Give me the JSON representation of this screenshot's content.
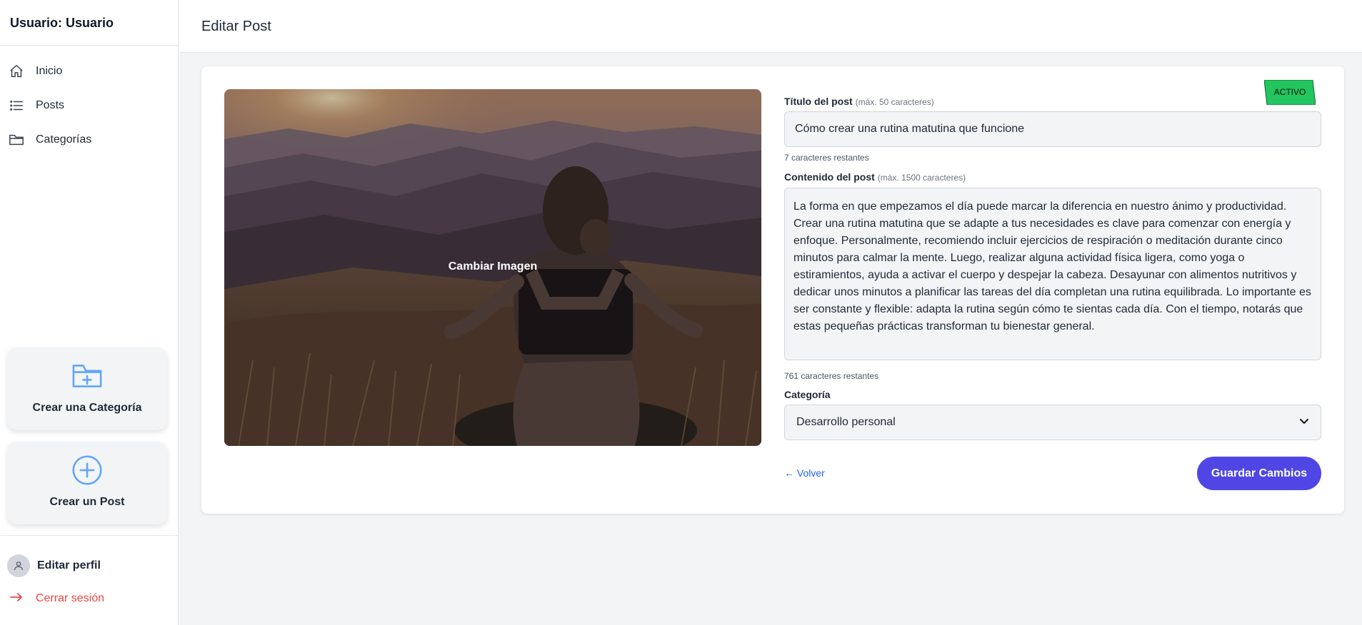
{
  "sidebar": {
    "user": "Usuario: Usuario",
    "nav": [
      {
        "label": "Inicio",
        "icon": "home-icon"
      },
      {
        "label": "Posts",
        "icon": "list-icon"
      },
      {
        "label": "Categorías",
        "icon": "folder-icon"
      }
    ],
    "create_category": "Crear una Categoría",
    "create_post": "Crear un Post",
    "profile": "Editar perfil",
    "logout": "Cerrar sesión"
  },
  "header": {
    "title": "Editar Post"
  },
  "editor": {
    "change_image": "Cambiar Imagen",
    "status": "ACTIVO",
    "status_color": "#22c55e",
    "title_label": "Título del post",
    "title_limit": "(máx. 50 caracteres)",
    "title_value": "Cómo crear una rutina matutina que funcione",
    "title_remaining": "7 caracteres restantes",
    "content_label": "Contenido del post",
    "content_limit": "(máx. 1500 caracteres)",
    "content_value": "La forma en que empezamos el día puede marcar la diferencia en nuestro ánimo y productividad.\nCrear una rutina matutina que se adapte a tus necesidades es clave para comenzar con energía y\nenfoque. Personalmente, recomiendo incluir ejercicios de respiración o meditación durante cinco\nminutos para calmar la mente. Luego, realizar alguna actividad física ligera, como yoga o\nestiramientos, ayuda a activar el cuerpo y despejar la cabeza. Desayunar con alimentos nutritivos y\ndedicar unos minutos a planificar las tareas del día completan una rutina equilibrada. Lo importante es\nser constante y flexible: adapta la rutina según cómo te sientas cada día. Con el tiempo, notarás que\nestas pequeñas prácticas transforman tu bienestar general.",
    "content_remaining": "761 caracteres restantes",
    "category_label": "Categoría",
    "category_value": "Desarrollo personal",
    "back": "← Volver",
    "save": "Guardar Cambios"
  },
  "colors": {
    "accent": "#4f46e5",
    "danger": "#ef4444",
    "link": "#2563eb"
  }
}
